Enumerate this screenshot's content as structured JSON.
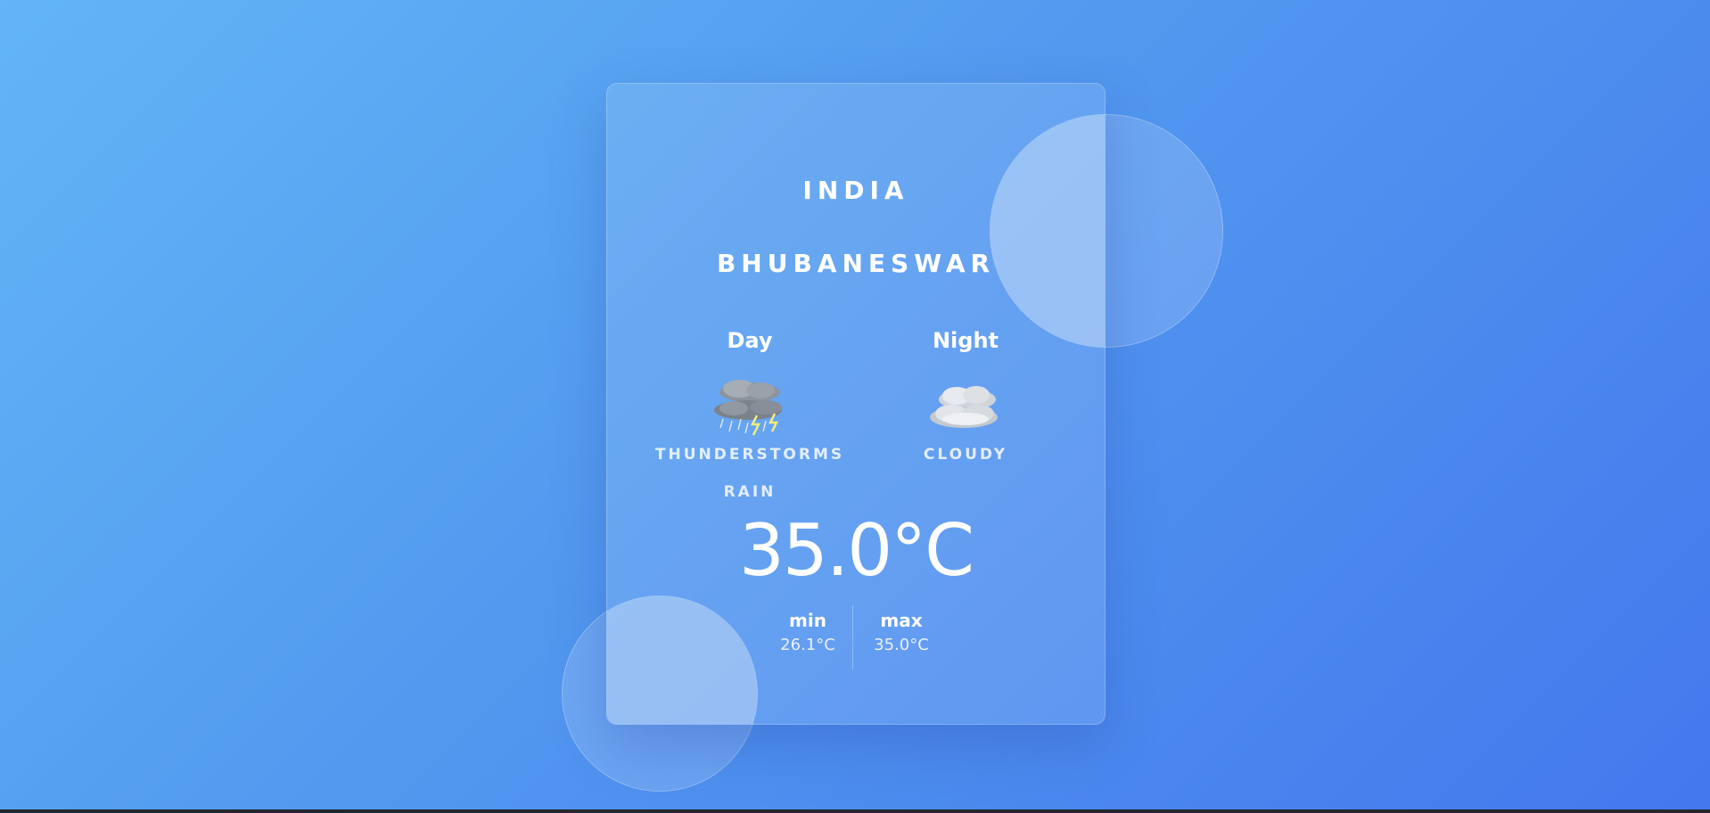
{
  "location": {
    "country": "INDIA",
    "city": "BHUBANESWAR"
  },
  "day": {
    "label": "Day",
    "icon": "thunderstorm-icon",
    "phrase": "THUNDERSTORMS",
    "precipitation": "RAIN"
  },
  "night": {
    "label": "Night",
    "icon": "cloudy-icon",
    "phrase": "CLOUDY"
  },
  "temperature": {
    "current": "35.0°C",
    "min_label": "min",
    "min_value": "26.1°C",
    "max_label": "max",
    "max_value": "35.0°C"
  },
  "colors": {
    "background_start": "#62b5f6",
    "background_end": "#4478ee",
    "text": "#ffffff"
  }
}
